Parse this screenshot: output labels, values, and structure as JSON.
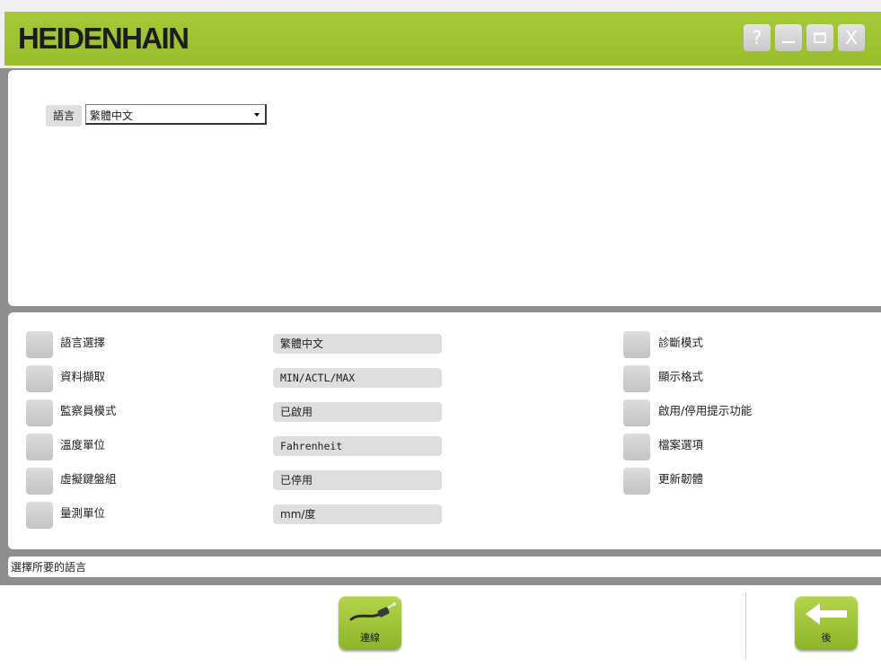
{
  "header": {
    "logo_text": "HEIDENHAIN",
    "help_label": "?",
    "close_label": "X"
  },
  "language_panel": {
    "label": "語言",
    "selected": "繁體中文"
  },
  "settings": {
    "left": [
      {
        "label": "語言選擇",
        "value": "繁體中文",
        "mono": false
      },
      {
        "label": "資料擷取",
        "value": "MIN/ACTL/MAX",
        "mono": true
      },
      {
        "label": "監察員模式",
        "value": "已啟用",
        "mono": false
      },
      {
        "label": "溫度單位",
        "value": "Fahrenheit",
        "mono": true
      },
      {
        "label": "虛擬鍵盤組",
        "value": "已停用",
        "mono": false
      },
      {
        "label": "量測單位",
        "value": "mm/度",
        "mono": false
      }
    ],
    "right": [
      {
        "label": "診斷模式"
      },
      {
        "label": "顯示格式"
      },
      {
        "label": "啟用/停用提示功能"
      },
      {
        "label": "檔案選項"
      },
      {
        "label": "更新韌體"
      }
    ]
  },
  "status_bar": {
    "text": "選擇所要的語言"
  },
  "toolbar": {
    "connect_label": "連線",
    "back_label": "後"
  },
  "colors": {
    "accent_green": "#9cc233",
    "panel_bg": "#ffffff",
    "frame_gray": "#8e8e8e",
    "field_gray": "#dedede"
  }
}
